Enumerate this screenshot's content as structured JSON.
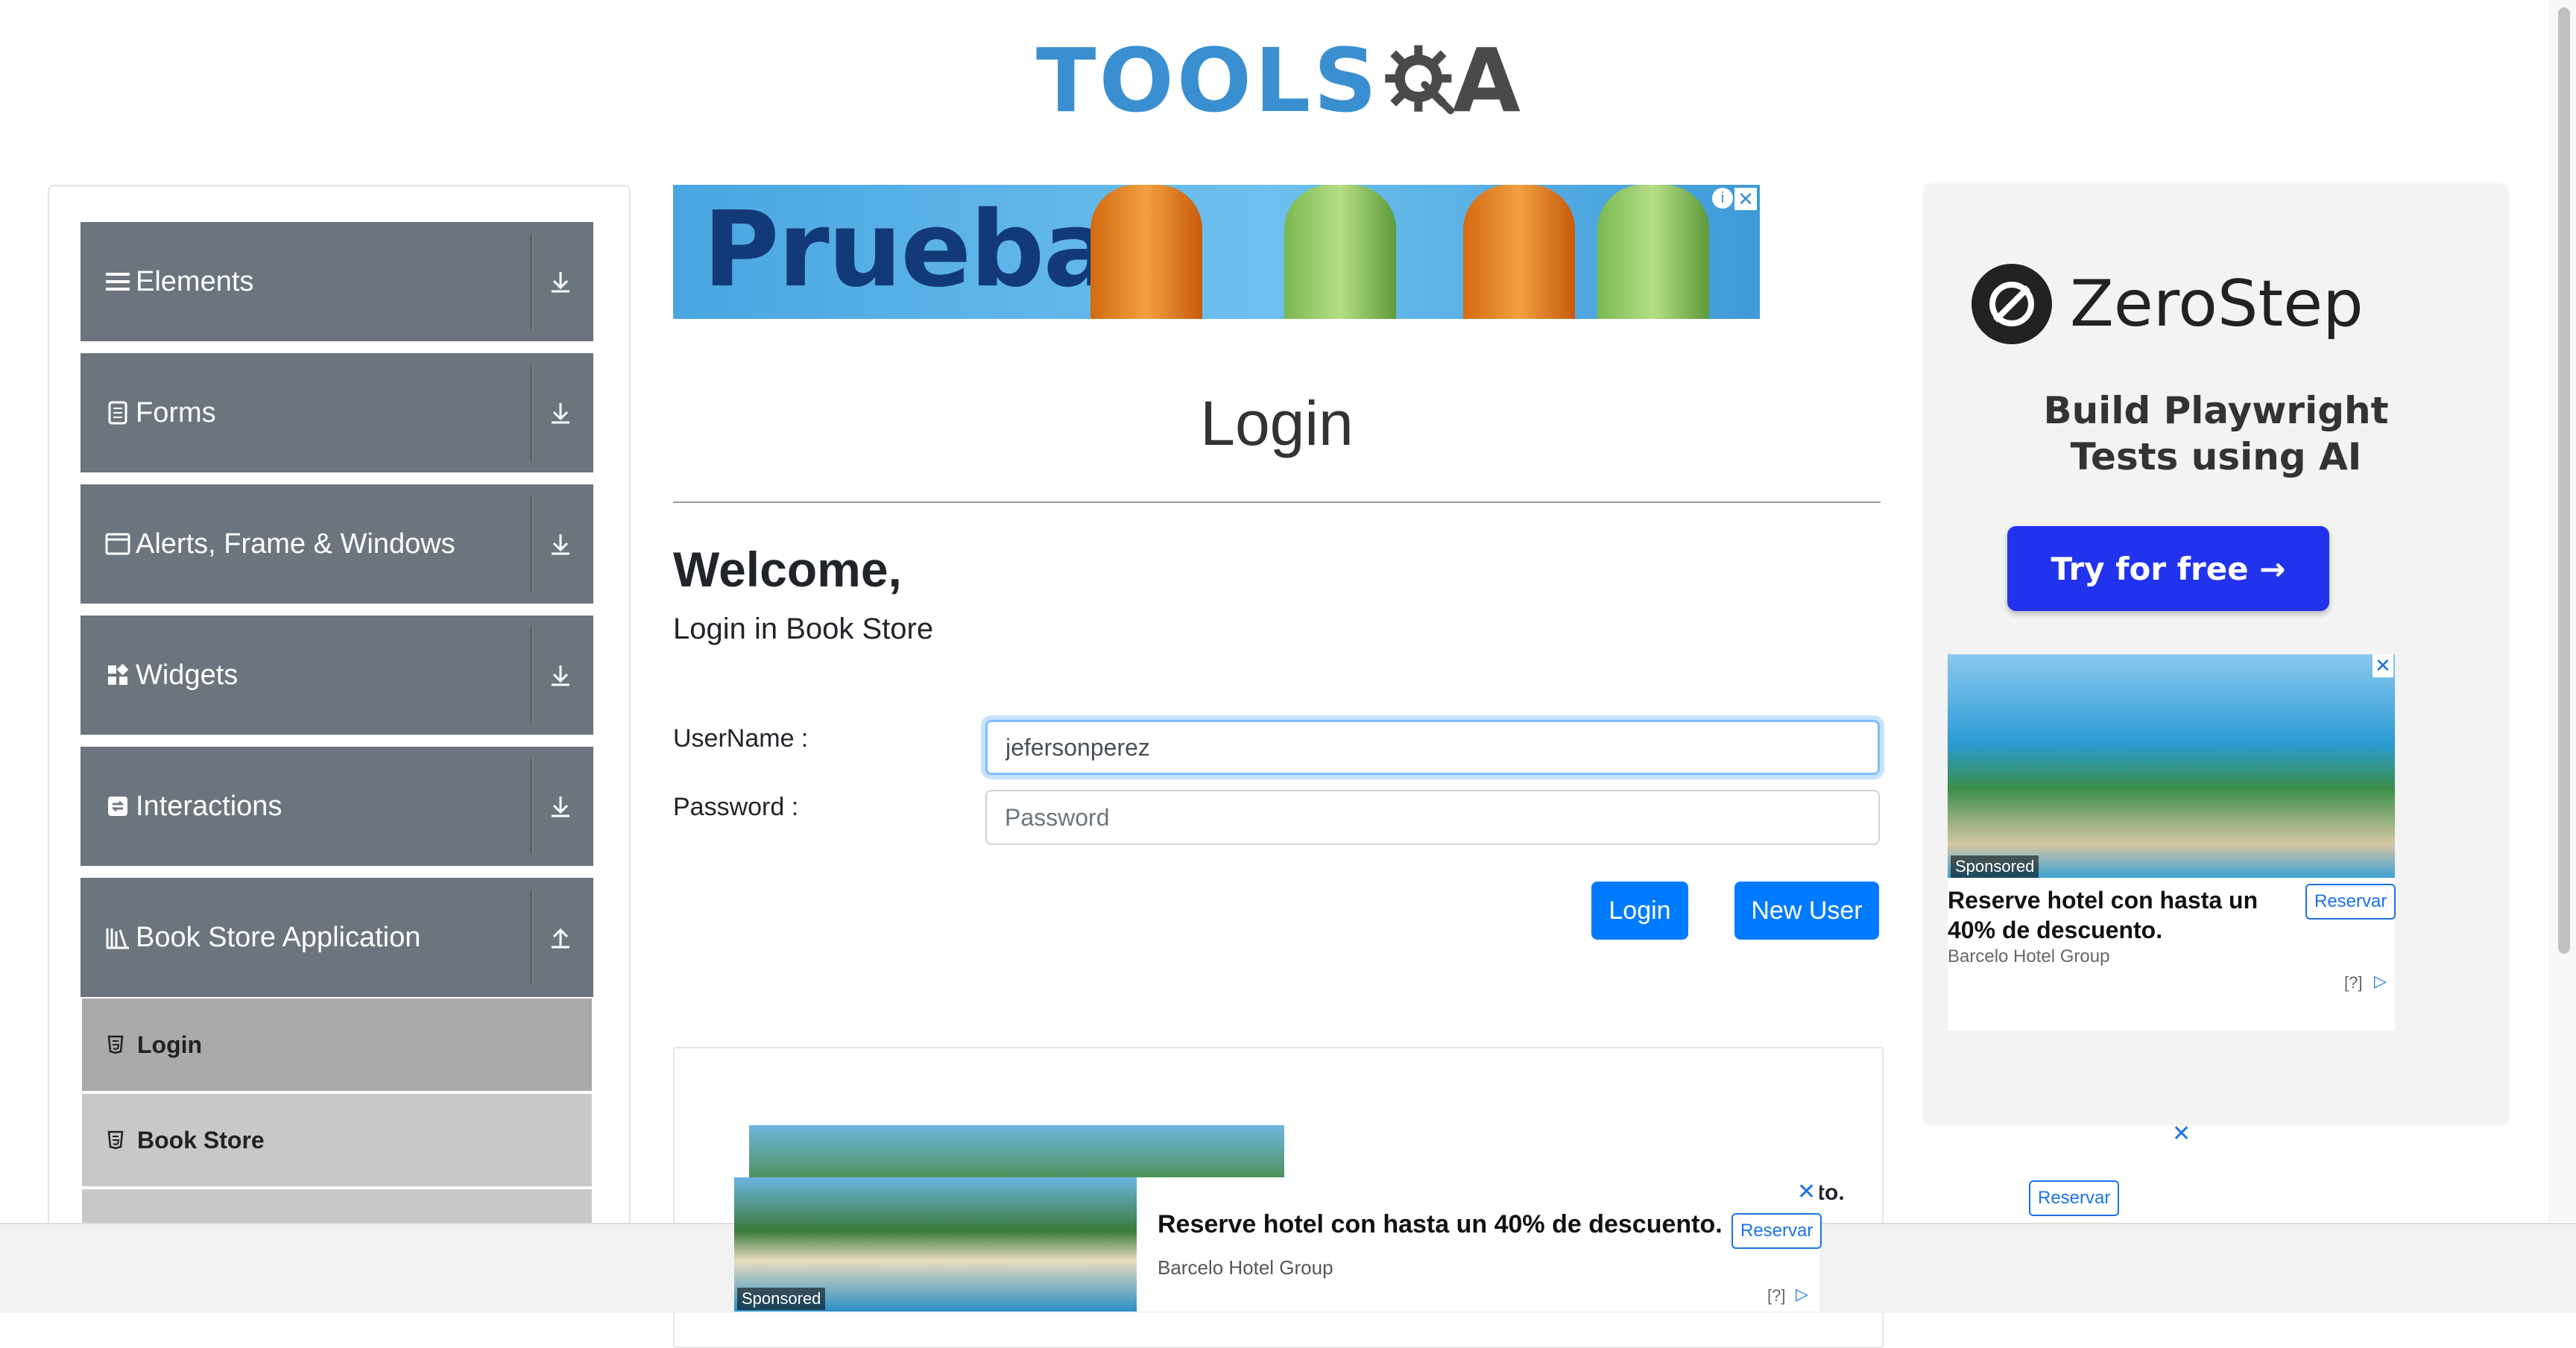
{
  "header": {
    "logo_text": "TOOLS",
    "logo_suffix": "A"
  },
  "sidebar": {
    "groups": [
      {
        "label": "Elements",
        "icon": "hamburger-icon",
        "state": "collapsed"
      },
      {
        "label": "Forms",
        "icon": "document-icon",
        "state": "collapsed"
      },
      {
        "label": "Alerts, Frame & Windows",
        "icon": "window-icon",
        "state": "collapsed"
      },
      {
        "label": "Widgets",
        "icon": "widgets-icon",
        "state": "collapsed"
      },
      {
        "label": "Interactions",
        "icon": "interactions-icon",
        "state": "collapsed"
      },
      {
        "label": "Book Store Application",
        "icon": "books-icon",
        "state": "expanded"
      }
    ],
    "subitems": [
      {
        "label": "Login",
        "active": true
      },
      {
        "label": "Book Store",
        "active": false
      }
    ]
  },
  "top_ad": {
    "text": "Prueba"
  },
  "main": {
    "title": "Login",
    "welcome": "Welcome,",
    "subtitle": "Login in Book Store",
    "username_label": "UserName :",
    "username_value": "jefersonperez",
    "password_label": "Password :",
    "password_placeholder": "Password",
    "login_button": "Login",
    "new_user_button": "New User"
  },
  "right_ad": {
    "brand": "ZeroStep",
    "tagline_line1": "Build Playwright",
    "tagline_line2": "Tests using AI",
    "cta": "Try for free →",
    "inner": {
      "sponsored": "Sponsored",
      "title": "Reserve hotel con hasta un 40% de descuento.",
      "advertiser": "Barcelo Hotel Group",
      "button": "Reservar",
      "info": "[?]"
    }
  },
  "lower_ad": {
    "partial_text": "to.",
    "button": "Reservar"
  },
  "bottom_ad": {
    "sponsored": "Sponsored",
    "title": "Reserve hotel con hasta un 40% de descuento.",
    "advertiser": "Barcelo Hotel Group",
    "button": "Reservar",
    "info": "[?]"
  },
  "colors": {
    "sidebar_group": "#6c757d",
    "primary": "#007bff",
    "logo_blue": "#3a8fd0",
    "cta_blue": "#2233ee"
  }
}
